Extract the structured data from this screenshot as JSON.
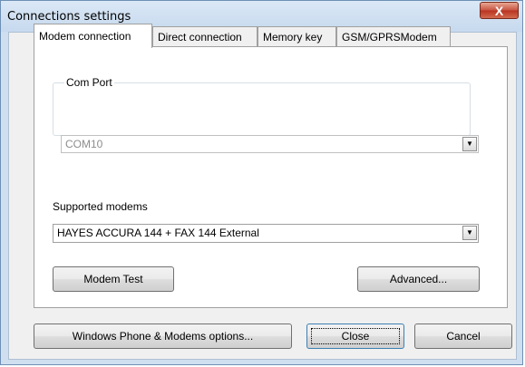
{
  "window": {
    "title": "Connections settings",
    "close_glyph": "X"
  },
  "tabs": [
    {
      "label": "Modem connection",
      "active": true
    },
    {
      "label": "Direct connection",
      "active": false
    },
    {
      "label": "Memory key",
      "active": false
    },
    {
      "label": "GSM/GPRSModem",
      "active": false
    }
  ],
  "com_port": {
    "group_label": "Com Port",
    "value": "COM10",
    "enabled": false
  },
  "supported_modems": {
    "label": "Supported modems",
    "value": "HAYES ACCURA 144 + FAX 144 External"
  },
  "buttons": {
    "modem_test": "Modem Test",
    "advanced": "Advanced...",
    "windows_phone": "Windows Phone & Modems options...",
    "close": "Close",
    "cancel": "Cancel"
  },
  "icons": {
    "dropdown": "chevron-down-icon",
    "close": "close-icon"
  },
  "colors": {
    "title_close_button": "#c75240",
    "title_bar": "#c6d9ee"
  }
}
